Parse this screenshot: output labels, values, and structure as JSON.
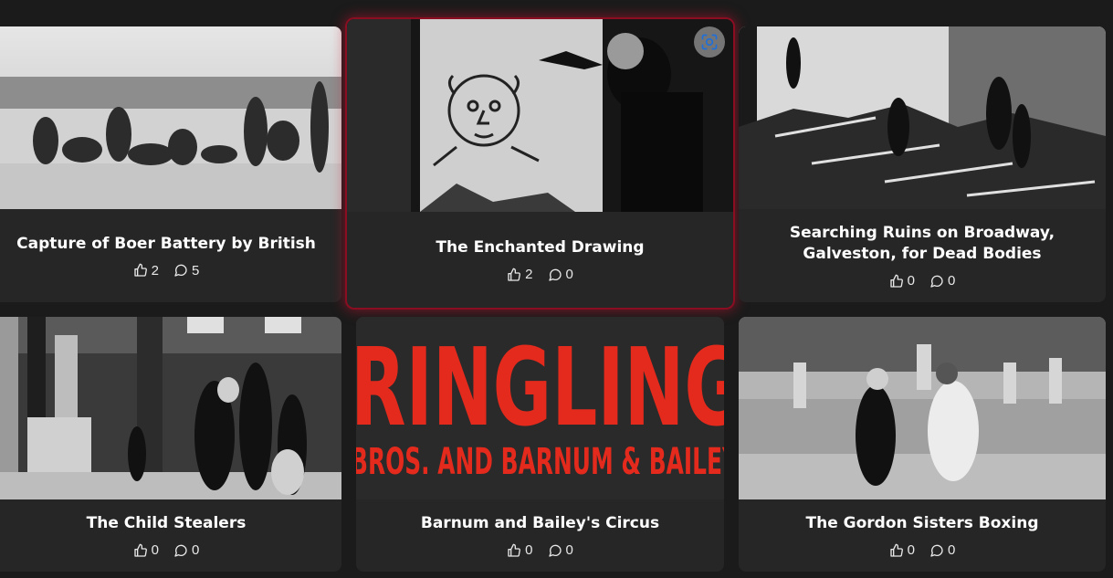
{
  "videos": [
    {
      "title": "Capture of Boer Battery by British",
      "likes": "2",
      "comments": "5"
    },
    {
      "title": "The Enchanted Drawing",
      "likes": "2",
      "comments": "0"
    },
    {
      "title": "Searching Ruins on Broadway, Galveston, for Dead Bodies",
      "likes": "0",
      "comments": "0"
    },
    {
      "title": "The Child Stealers",
      "likes": "0",
      "comments": "0"
    },
    {
      "title": "Barnum and Bailey's Circus",
      "likes": "0",
      "comments": "0"
    },
    {
      "title": "The Gordon Sisters Boxing",
      "likes": "0",
      "comments": "0"
    }
  ],
  "thumbnail_text": {
    "circus_line1": "RINGLING",
    "circus_line2": "BROS. AND BARNUM & BAILEY"
  },
  "colors": {
    "card_bg": "#262626",
    "page_bg": "#1b1b1b",
    "active_glow": "#8a0d22",
    "circus_red": "#e42a1d",
    "focus_icon": "#1e6fd9"
  },
  "icons": {
    "like": "thumbs-up-icon",
    "comment": "comment-bubble-icon",
    "focus": "focus-scan-icon"
  }
}
